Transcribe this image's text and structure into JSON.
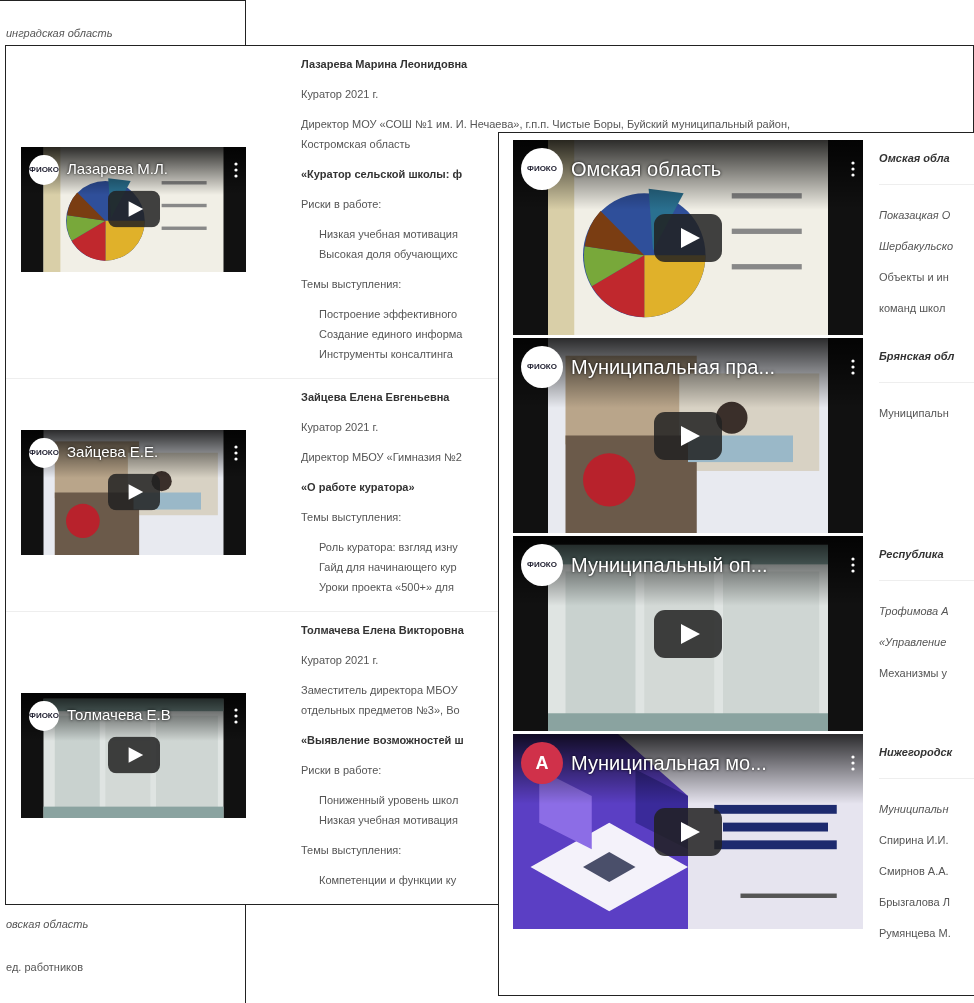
{
  "background_page": {
    "top_lines": [
      {
        "text": "инградская область",
        "italic": true
      }
    ],
    "bottom_lines": [
      {
        "text": "овская область",
        "italic": true
      },
      {
        "text": "ед. работников",
        "italic": false
      }
    ]
  },
  "curators_page": {
    "entries": [
      {
        "video": {
          "channel": "ФИОКО",
          "title": "Лазарева М.Л."
        },
        "name": "Лазарева Марина Леонидовна",
        "role": "Куратор 2021 г.",
        "position": [
          "Директор МОУ «СОШ №1 им. И. Нечаева», г.п.п. Чистые Боры, Буйский муниципальный район,",
          "Костромская область"
        ],
        "topic": "«Куратор сельской школы: ф",
        "sections": [
          {
            "heading": "Риски в работе:",
            "items": [
              "Низкая учебная мотивация",
              "Высокая доля обучающихс"
            ]
          },
          {
            "heading": "Темы выступления:",
            "items": [
              "Построение эффективного",
              "Создание единого информа",
              "Инструменты консалтинга"
            ]
          }
        ]
      },
      {
        "video": {
          "channel": "ФИОКО",
          "title": "Зайцева Е.Е."
        },
        "name": "Зайцева Елена Евгеньевна",
        "role": "Куратор 2021 г.",
        "position": [
          "Директор МБОУ «Гимназия №2"
        ],
        "topic": "«О работе куратора»",
        "sections": [
          {
            "heading": "Темы выступления:",
            "items": [
              "Роль куратора: взгляд изну",
              "Гайд для начинающего кур",
              "Уроки проекта «500+» для"
            ]
          }
        ]
      },
      {
        "video": {
          "channel": "ФИОКО",
          "title": "Толмачева Е.В"
        },
        "name": "Толмачева Елена Викторовна",
        "role": "Куратор 2021 г.",
        "position": [
          "Заместитель директора МБОУ",
          "отдельных предметов №3», Во"
        ],
        "topic": "«Выявление возможностей ш",
        "sections": [
          {
            "heading": "Риски в работе:",
            "items": [
              "Пониженный уровень школ",
              "Низкая учебная мотивация"
            ]
          },
          {
            "heading": "Темы выступления:",
            "items": [
              "Компетенции и функции ку"
            ]
          }
        ]
      }
    ]
  },
  "regions_page": {
    "entries": [
      {
        "video": {
          "channel": "ФИОКО",
          "title": "Омская область"
        },
        "region": "Омская обла",
        "lines": [
          {
            "text": "Показацкая О",
            "italic": true
          },
          {
            "text": "Шербакульско",
            "italic": true
          },
          {
            "text": "Объекты и ин",
            "italic": false
          },
          {
            "text": "команд школ",
            "italic": false
          }
        ]
      },
      {
        "video": {
          "channel": "ФИОКО",
          "title": "Муниципальная пра..."
        },
        "region": "Брянская обл",
        "lines": [
          {
            "text": "Муниципальн",
            "italic": false
          }
        ]
      },
      {
        "video": {
          "channel": "ФИОКО",
          "title": "Муниципальный оп..."
        },
        "region": "Республика",
        "lines": [
          {
            "text": "Трофимова А",
            "italic": true
          },
          {
            "text": "«Управление",
            "italic": true
          },
          {
            "text": "Механизмы у",
            "italic": false
          }
        ]
      },
      {
        "video": {
          "channel": "A",
          "title": "Муниципальная мо..."
        },
        "region": "Нижегородск",
        "lines": [
          {
            "text": "Муниципальн",
            "italic": true
          },
          {
            "text": "Спирина И.И.",
            "italic": false
          },
          {
            "text": "Смирнов А.А.",
            "italic": false
          },
          {
            "text": "Брызгалова Л",
            "italic": false
          },
          {
            "text": "Румянцева М.",
            "italic": false
          }
        ]
      }
    ]
  }
}
